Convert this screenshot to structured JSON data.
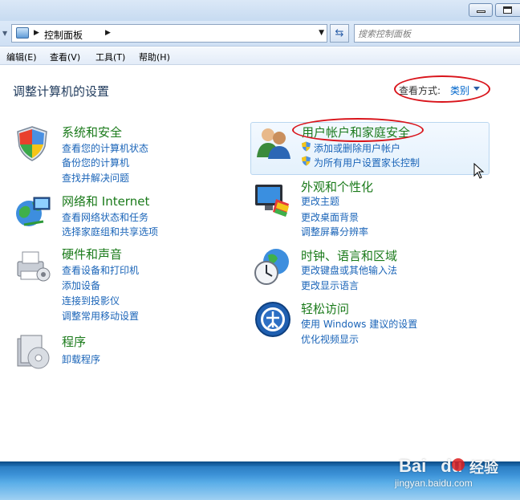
{
  "address": {
    "breadcrumb": "控制面板",
    "search_placeholder": "搜索控制面板"
  },
  "menu": [
    "编辑(E)",
    "查看(V)",
    "工具(T)",
    "帮助(H)"
  ],
  "main": {
    "title": "调整计算机的设置",
    "view_by_label": "查看方式:",
    "view_by_value": "类别"
  },
  "categories": {
    "system_security": {
      "title": "系统和安全",
      "links": [
        "查看您的计算机状态",
        "备份您的计算机",
        "查找并解决问题"
      ],
      "icon": "shield-icon"
    },
    "network": {
      "title": "网络和 Internet",
      "links": [
        "查看网络状态和任务",
        "选择家庭组和共享选项"
      ],
      "icon": "globe-network-icon"
    },
    "hardware_sound": {
      "title": "硬件和声音",
      "links": [
        "查看设备和打印机",
        "添加设备",
        "连接到投影仪",
        "调整常用移动设置"
      ],
      "icon": "printer-icon"
    },
    "programs": {
      "title": "程序",
      "links": [
        "卸载程序"
      ],
      "icon": "programs-disc-icon"
    },
    "user_accounts": {
      "title": "用户帐户和家庭安全",
      "links": [
        "添加或删除用户帐户",
        "为所有用户设置家长控制"
      ],
      "icon": "users-icon"
    },
    "appearance": {
      "title": "外观和个性化",
      "links": [
        "更改主题",
        "更改桌面背景",
        "调整屏幕分辨率"
      ],
      "icon": "monitor-palette-icon"
    },
    "clock_language": {
      "title": "时钟、语言和区域",
      "links": [
        "更改键盘或其他输入法",
        "更改显示语言"
      ],
      "icon": "clock-globe-icon"
    },
    "ease_access": {
      "title": "轻松访问",
      "links": [
        "使用 Windows 建议的设置",
        "优化视频显示"
      ],
      "icon": "ease-of-access-icon"
    }
  },
  "watermark": {
    "brand": "Bai",
    "brand2": "du",
    "jingyan": "经验",
    "url": "jingyan.baidu.com"
  },
  "colors": {
    "category_title": "#1a7a1a",
    "link": "#1a64b8",
    "highlight_ellipse": "#d9141b"
  }
}
